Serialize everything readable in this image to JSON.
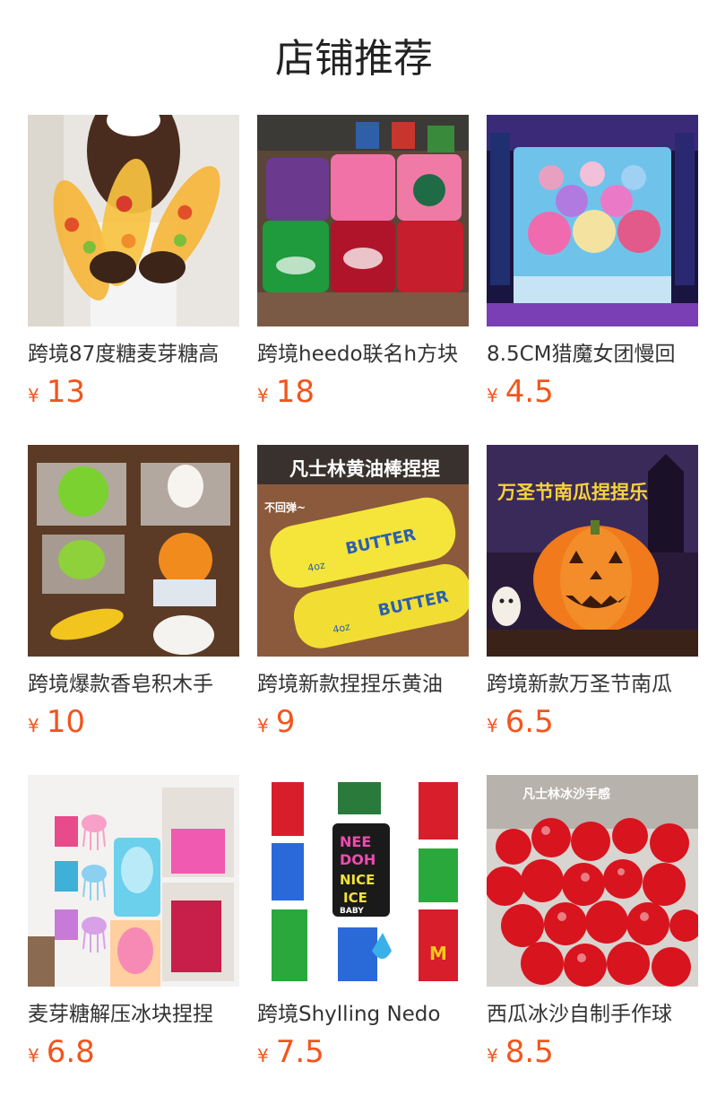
{
  "section": {
    "title": "店铺推荐"
  },
  "currency_symbol": "¥",
  "accent_color": "#f2551d",
  "products": [
    {
      "title": "跨境87度糖麦芽糖高",
      "price": "13",
      "image": "hands-holding-fruit-jelly-bananas"
    },
    {
      "title": "跨境heedo联名h方块",
      "price": "18",
      "image": "soda-brand-ice-cubes"
    },
    {
      "title": "8.5CM猎魔女团慢回",
      "price": "4.5",
      "image": "mystery-dumpling-box"
    },
    {
      "title": "跨境爆款香皂积木手",
      "price": "10",
      "image": "fruit-squishies-on-cups"
    },
    {
      "title": "跨境新款捏捏乐黄油",
      "price": "9",
      "image": "butter-stick-squishy",
      "overlay_text": "凡士林黄油棒捏捏",
      "sub_text": "不回弹~",
      "label_text": "BUTTER",
      "weight_text": "4oz"
    },
    {
      "title": "跨境新款万圣节南瓜",
      "price": "6.5",
      "image": "glowing-pumpkin",
      "overlay_text": "万圣节南瓜捏捏乐"
    },
    {
      "title": "麦芽糖解压冰块捏捏",
      "price": "6.8",
      "image": "jellyfish-ice-cream-squishies"
    },
    {
      "title": "跨境Shylling Nedo",
      "price": "7.5",
      "image": "nice-ice-baby-packages",
      "label_text": "NEE DOH NICE ICE BABY"
    },
    {
      "title": "西瓜冰沙自制手作球",
      "price": "8.5",
      "image": "red-slush-balls",
      "overlay_text": "凡士林冰沙手感"
    }
  ]
}
